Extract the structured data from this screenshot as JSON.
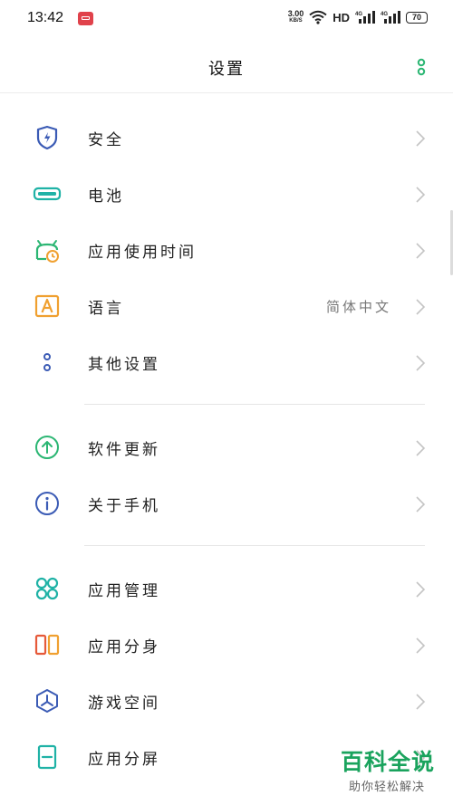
{
  "status_bar": {
    "time": "13:42",
    "speed_value": "3.00",
    "speed_unit": "KB/S",
    "hd": "HD",
    "battery": "70"
  },
  "header": {
    "title": "设置"
  },
  "items": [
    {
      "label": "安全",
      "icon": "shield-icon"
    },
    {
      "label": "电池",
      "icon": "battery-icon"
    },
    {
      "label": "应用使用时间",
      "icon": "app-timer-icon"
    },
    {
      "label": "语言",
      "value": "简体中文",
      "icon": "language-icon"
    },
    {
      "label": "其他设置",
      "icon": "more-settings-icon"
    },
    {
      "label": "软件更新",
      "icon": "update-icon"
    },
    {
      "label": "关于手机",
      "icon": "info-icon"
    },
    {
      "label": "应用管理",
      "icon": "app-manager-icon"
    },
    {
      "label": "应用分身",
      "icon": "app-clone-icon"
    },
    {
      "label": "游戏空间",
      "icon": "game-space-icon"
    },
    {
      "label": "应用分屏",
      "icon": "split-screen-icon"
    }
  ],
  "watermark": {
    "title": "百科全说",
    "subtitle": "助你轻松解决"
  },
  "colors": {
    "accent_green": "#2bb673",
    "icon_blue": "#3b5bb5",
    "icon_teal": "#1fb2a6",
    "icon_orange": "#f0a030",
    "watermark_green": "#1aa35d"
  }
}
